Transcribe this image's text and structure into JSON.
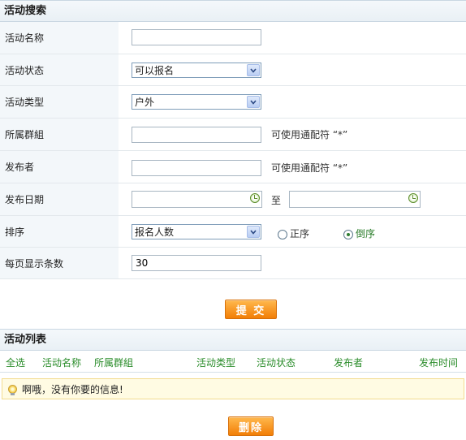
{
  "search": {
    "title": "活动搜索",
    "name_label": "活动名称",
    "name_value": "",
    "status_label": "活动状态",
    "status_value": "可以报名",
    "type_label": "活动类型",
    "type_value": "户外",
    "group_label": "所属群組",
    "group_value": "",
    "group_hint": "可使用通配符 “*”",
    "publisher_label": "发布者",
    "publisher_value": "",
    "publisher_hint": "可使用通配符 “*”",
    "date_label": "发布日期",
    "date_from": "",
    "date_to_sep": "至",
    "date_to": "",
    "sort_label": "排序",
    "sort_value": "报名人数",
    "sort_asc": "正序",
    "sort_desc": "倒序",
    "sort_selected": "倒序",
    "perpage_label": "每页显示条数",
    "perpage_value": "30",
    "submit_label": "提 交"
  },
  "list": {
    "title": "活动列表",
    "columns": [
      "全选",
      "活动名称",
      "所属群組",
      "活动类型",
      "活动状态",
      "发布者",
      "发布时间"
    ],
    "empty_message": "啊哦，没有你要的信息!",
    "delete_label": "删除"
  },
  "colors": {
    "accent_orange": "#f28a10",
    "header_green": "#2a8c2a",
    "label_bg": "#f3f7fa"
  }
}
